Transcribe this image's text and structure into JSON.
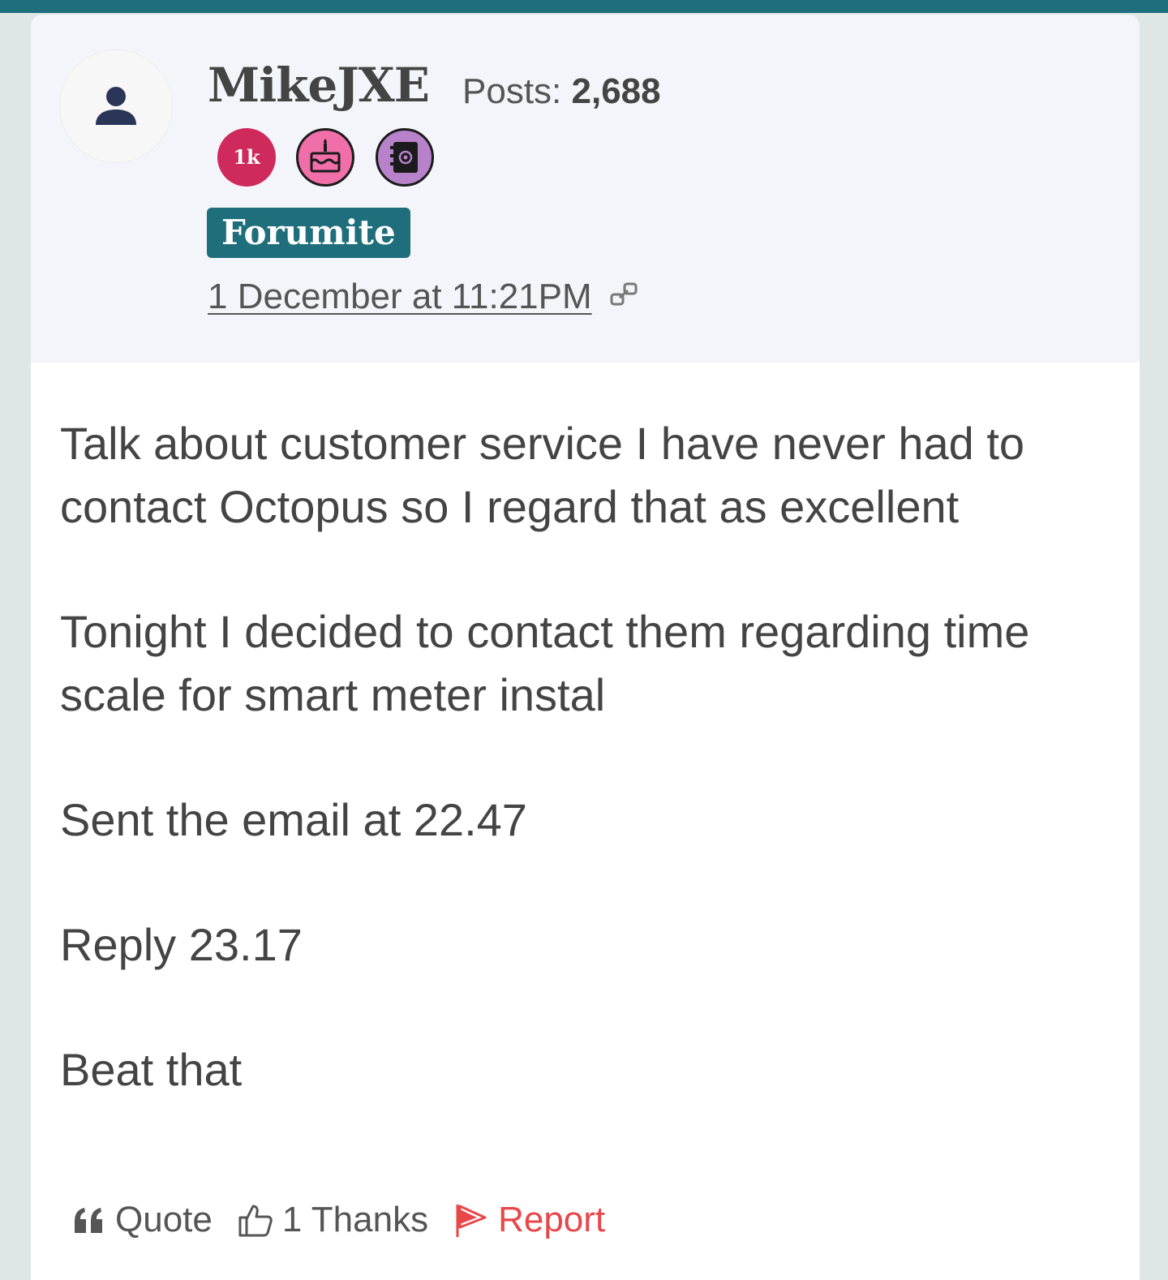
{
  "post": {
    "author": {
      "username": "MikeJXE",
      "posts_label": "Posts:",
      "posts_count": "2,688",
      "role": "Forumite",
      "badges": [
        {
          "name": "1k-posts-badge",
          "text": "1k",
          "color": "#cf2a5c"
        },
        {
          "name": "cake-badge",
          "icon": "birthday-cake-icon",
          "color": "#f06fa8"
        },
        {
          "name": "address-book-badge",
          "icon": "address-book-icon",
          "color": "#b782c9"
        }
      ]
    },
    "timestamp": "1 December at 11:21PM",
    "body": [
      "Talk about customer service I have never had to contact Octopus so I regard that as excellent",
      "Tonight I decided to contact them regarding time scale for smart meter instal",
      "Sent the email at 22.47",
      "Reply 23.17",
      "Beat that"
    ],
    "actions": {
      "quote": "Quote",
      "thanks": "1 Thanks",
      "report": "Report"
    }
  },
  "colors": {
    "brand": "#1f6e7c",
    "report": "#e8474a",
    "header_bg": "#f4f5fa",
    "page_bg": "#dfe6e6"
  }
}
